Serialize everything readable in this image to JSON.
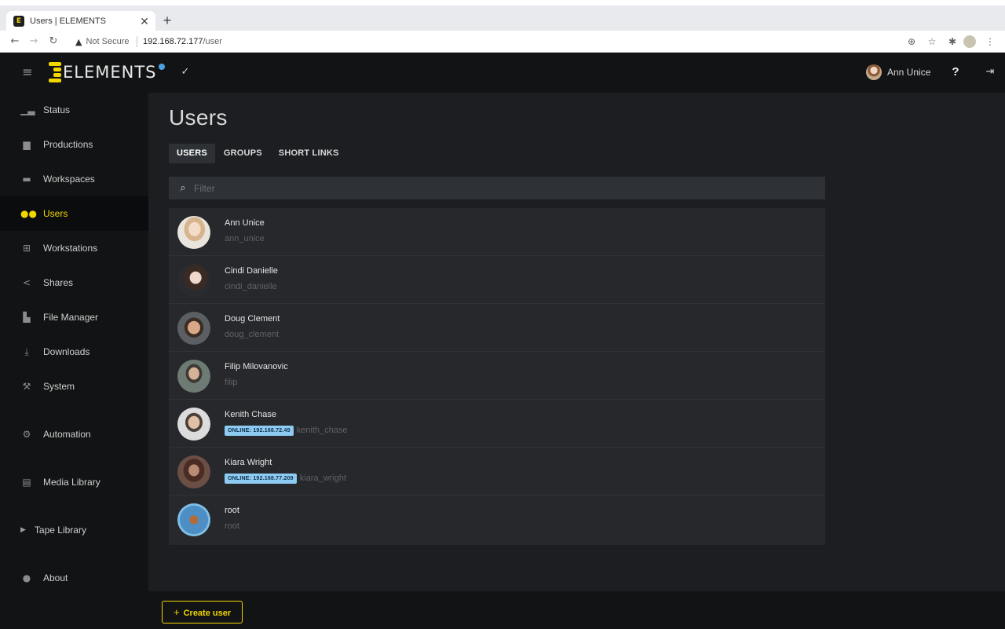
{
  "browser": {
    "tab_title": "Users | ELEMENTS",
    "tab_favicon": "E",
    "security_label": "Not Secure",
    "url_host": "192.168.72.177",
    "url_path": "/user"
  },
  "app": {
    "logo_text": "ELEMENTS",
    "current_user": "Ann Unice"
  },
  "sidebar": {
    "items": [
      {
        "label": "Status",
        "icon": "chart-icon"
      },
      {
        "label": "Productions",
        "icon": "briefcase-icon"
      },
      {
        "label": "Workspaces",
        "icon": "folder-icon"
      },
      {
        "label": "Users",
        "icon": "users-icon",
        "active": true
      },
      {
        "label": "Workstations",
        "icon": "network-icon"
      },
      {
        "label": "Shares",
        "icon": "share-icon"
      },
      {
        "label": "File Manager",
        "icon": "file-manager-icon"
      },
      {
        "label": "Downloads",
        "icon": "download-icon"
      },
      {
        "label": "System",
        "icon": "wrench-icon"
      },
      {
        "label": "Automation",
        "icon": "gears-icon"
      },
      {
        "label": "Media Library",
        "icon": "film-icon"
      },
      {
        "label": "Tape Library",
        "icon": "caret-right-icon"
      },
      {
        "label": "About",
        "icon": "info-icon"
      }
    ]
  },
  "main": {
    "title": "Users",
    "tabs": [
      "USERS",
      "GROUPS",
      "SHORT LINKS"
    ],
    "filter_placeholder": "Filter",
    "users": [
      {
        "name": "Ann Unice",
        "login": "ann_unice",
        "online": ""
      },
      {
        "name": "Cindi Danielle",
        "login": "cindi_danielle",
        "online": ""
      },
      {
        "name": "Doug Clement",
        "login": "doug_clement",
        "online": ""
      },
      {
        "name": "Filip Milovanovic",
        "login": "filip",
        "online": ""
      },
      {
        "name": "Kenith Chase",
        "login": "kenith_chase",
        "online": "ONLINE: 192.168.72.49"
      },
      {
        "name": "Kiara Wright",
        "login": "kiara_wright",
        "online": "ONLINE: 192.168.77.209"
      },
      {
        "name": "root",
        "login": "root",
        "online": ""
      }
    ],
    "create_button_label": "Create user"
  },
  "colors": {
    "accent": "#f2d600",
    "online_badge": "#8ecbf3",
    "app_bg": "#1c1e21",
    "sidebar_bg": "#121314"
  }
}
